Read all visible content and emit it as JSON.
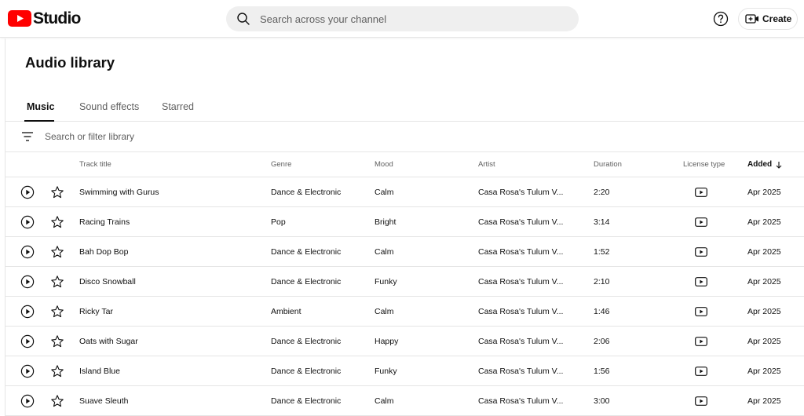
{
  "header": {
    "logo_text": "Studio",
    "search_placeholder": "Search across your channel",
    "create_label": "Create",
    "brand_color": "#ff0000"
  },
  "page": {
    "title": "Audio library"
  },
  "tabs": [
    {
      "label": "Music",
      "active": true
    },
    {
      "label": "Sound effects",
      "active": false
    },
    {
      "label": "Starred",
      "active": false
    }
  ],
  "filter": {
    "placeholder": "Search or filter library"
  },
  "table": {
    "columns": {
      "title": "Track title",
      "genre": "Genre",
      "mood": "Mood",
      "artist": "Artist",
      "duration": "Duration",
      "license": "License type",
      "added": "Added"
    },
    "sort": {
      "column": "added",
      "direction": "descending"
    },
    "rows": [
      {
        "title": "Swimming with Gurus",
        "genre": "Dance & Electronic",
        "mood": "Calm",
        "artist": "Casa Rosa's Tulum V...",
        "duration": "2:20",
        "license_icon": "youtube-license-icon",
        "added": "Apr 2025"
      },
      {
        "title": "Racing Trains",
        "genre": "Pop",
        "mood": "Bright",
        "artist": "Casa Rosa's Tulum V...",
        "duration": "3:14",
        "license_icon": "youtube-license-icon",
        "added": "Apr 2025"
      },
      {
        "title": "Bah Dop Bop",
        "genre": "Dance & Electronic",
        "mood": "Calm",
        "artist": "Casa Rosa's Tulum V...",
        "duration": "1:52",
        "license_icon": "youtube-license-icon",
        "added": "Apr 2025"
      },
      {
        "title": "Disco Snowball",
        "genre": "Dance & Electronic",
        "mood": "Funky",
        "artist": "Casa Rosa's Tulum V...",
        "duration": "2:10",
        "license_icon": "youtube-license-icon",
        "added": "Apr 2025"
      },
      {
        "title": "Ricky Tar",
        "genre": "Ambient",
        "mood": "Calm",
        "artist": "Casa Rosa's Tulum V...",
        "duration": "1:46",
        "license_icon": "youtube-license-icon",
        "added": "Apr 2025"
      },
      {
        "title": "Oats with Sugar",
        "genre": "Dance & Electronic",
        "mood": "Happy",
        "artist": "Casa Rosa's Tulum V...",
        "duration": "2:06",
        "license_icon": "youtube-license-icon",
        "added": "Apr 2025"
      },
      {
        "title": "Island Blue",
        "genre": "Dance & Electronic",
        "mood": "Funky",
        "artist": "Casa Rosa's Tulum V...",
        "duration": "1:56",
        "license_icon": "youtube-license-icon",
        "added": "Apr 2025"
      },
      {
        "title": "Suave Sleuth",
        "genre": "Dance & Electronic",
        "mood": "Calm",
        "artist": "Casa Rosa's Tulum V...",
        "duration": "3:00",
        "license_icon": "youtube-license-icon",
        "added": "Apr 2025"
      }
    ]
  }
}
